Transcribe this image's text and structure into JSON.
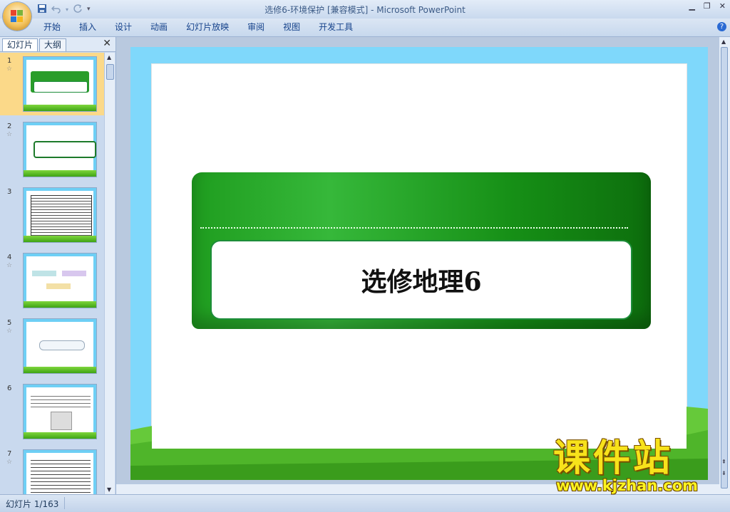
{
  "app": {
    "title": "选修6-环境保护 [兼容模式] - Microsoft PowerPoint"
  },
  "ribbon": {
    "tabs": [
      "开始",
      "插入",
      "设计",
      "动画",
      "幻灯片放映",
      "审阅",
      "视图",
      "开发工具"
    ]
  },
  "left_panel": {
    "tab_slides": "幻灯片",
    "tab_outline": "大纲",
    "slide_numbers": [
      "1",
      "2",
      "3",
      "4",
      "5",
      "6",
      "7"
    ],
    "selected": "1"
  },
  "slide": {
    "title": "选修地理6"
  },
  "status": {
    "text": "幻灯片 1/163"
  },
  "watermark": {
    "brand": "课件站",
    "url": "www.kjzhan.com"
  },
  "colors": {
    "accent_green": "#1f9d1f",
    "slide_border_blue": "#7fd8fb",
    "selection": "#fbd989"
  }
}
